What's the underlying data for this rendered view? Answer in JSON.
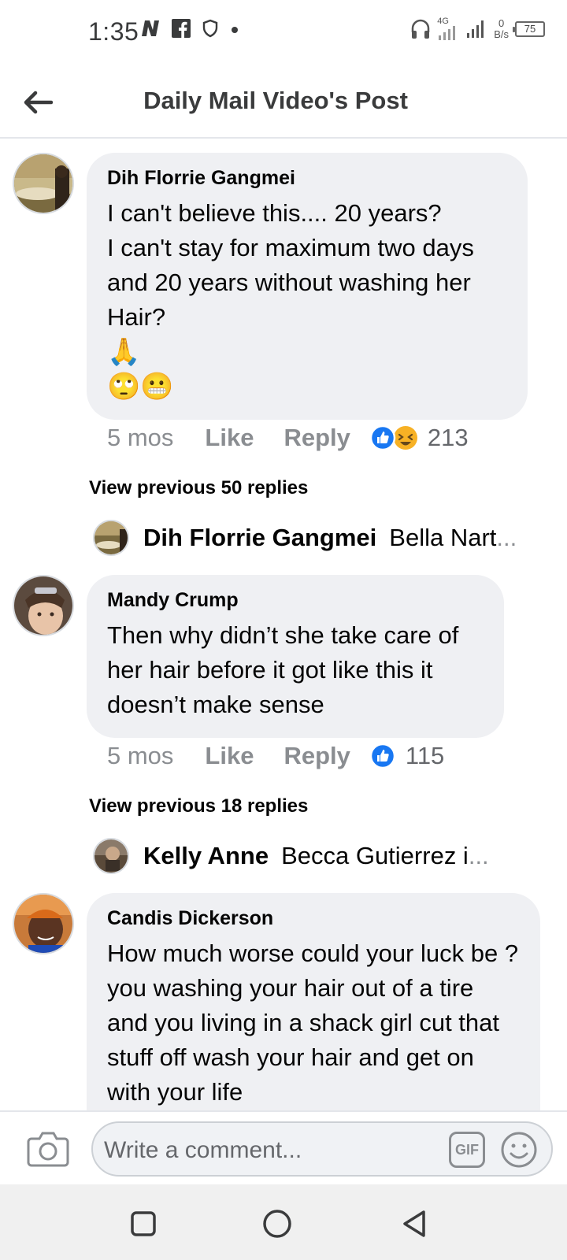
{
  "status_bar": {
    "time": "1:35",
    "network_label": "4G",
    "speed_value": "0",
    "speed_unit": "B/s",
    "battery": "75"
  },
  "header": {
    "title": "Daily Mail Video's Post"
  },
  "comments": [
    {
      "author": "Dih Florrie Gangmei",
      "text": "I can't believe this.... 20 years?\nI can't stay for maximum two days and 20 years without washing her Hair?",
      "emojis_line1": "🙏",
      "emojis_line2": "🙄😬",
      "time": "5 mos",
      "like_label": "Like",
      "reply_label": "Reply",
      "reaction_count": "213",
      "view_previous": "View previous 50 replies",
      "reply_preview": {
        "name": "Dih Florrie Gangmei",
        "text": "Bella Nart",
        "ellipsis": "..."
      }
    },
    {
      "author": "Mandy Crump",
      "text": "Then why didn’t she take care of her hair before it got like this it doesn’t make sense",
      "time": "5 mos",
      "like_label": "Like",
      "reply_label": "Reply",
      "reaction_count": "115",
      "view_previous": "View previous 18 replies",
      "reply_preview": {
        "name": "Kelly Anne",
        "text": "Becca Gutierrez i",
        "ellipsis": "..."
      }
    },
    {
      "author": "Candis Dickerson",
      "text": "How much worse could your luck be ? you washing your hair out of a tire and you living in a shack girl cut that stuff off wash your hair and get on with your life"
    }
  ],
  "composer": {
    "placeholder": "Write a comment...",
    "gif_label": "GIF"
  },
  "colors": {
    "bubble": "#eff0f3",
    "like_blue": "#1877f2",
    "meta_gray": "#8a8d91"
  }
}
